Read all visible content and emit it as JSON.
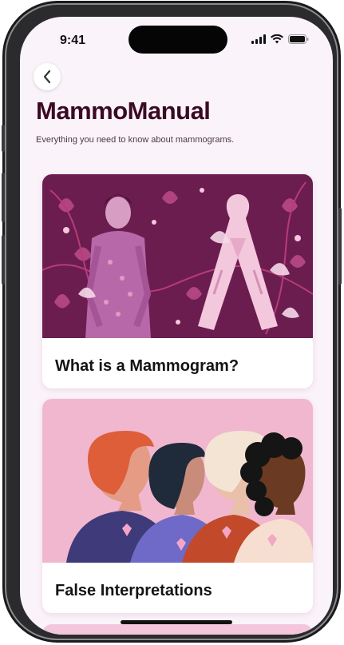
{
  "status_bar": {
    "time": "9:41"
  },
  "header": {
    "title": "MammoManual",
    "subtitle": "Everything you need to know about mammograms."
  },
  "cards": [
    {
      "label": "What is a Mammogram?"
    },
    {
      "label": "False Interpretations"
    }
  ],
  "colors": {
    "screen_bg": "#fbf3fa",
    "title": "#3a0a24",
    "card1_bg": "#6b1d4f",
    "card2_bg": "#f1b7cf"
  },
  "icons": [
    "back-chevron-icon",
    "signal-icon",
    "wifi-icon",
    "battery-icon"
  ]
}
